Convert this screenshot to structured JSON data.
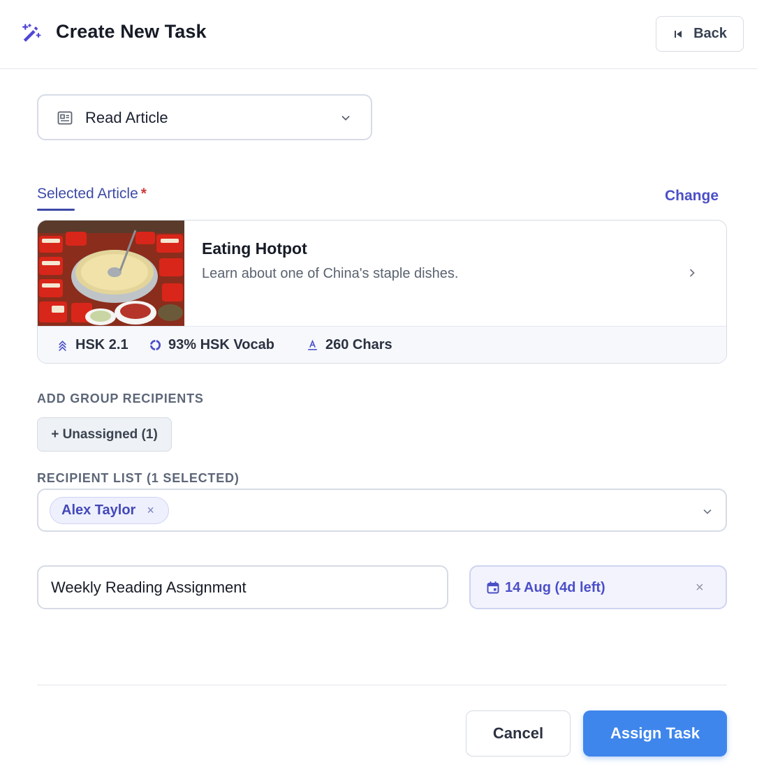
{
  "header": {
    "title": "Create New Task",
    "back_label": "Back",
    "icon": "magic-wand-icon"
  },
  "task_type": {
    "selected": "Read Article",
    "icon": "newspaper-icon"
  },
  "selected_article": {
    "label": "Selected Article",
    "required_mark": "*",
    "change_label": "Change",
    "title": "Eating Hotpot",
    "description": "Learn about one of China's staple dishes.",
    "meta": {
      "level": "HSK 2.1",
      "vocab": "93% HSK Vocab",
      "chars": "260 Chars"
    }
  },
  "group_recipients": {
    "label": "ADD GROUP RECIPIENTS",
    "chip": "+ Unassigned (1)"
  },
  "recipient_list": {
    "label": "RECIPIENT LIST (1 SELECTED)",
    "tags": [
      "Alex Taylor"
    ],
    "remove_glyph": "×"
  },
  "task_name": {
    "value": "Weekly Reading Assignment"
  },
  "due_date": {
    "value": "14 Aug (4d left)",
    "clear_glyph": "×"
  },
  "footer": {
    "cancel_label": "Cancel",
    "assign_label": "Assign Task"
  },
  "colors": {
    "accent": "#4b4fc7",
    "primary_button": "#3f86ec",
    "required": "#d23b3b"
  }
}
